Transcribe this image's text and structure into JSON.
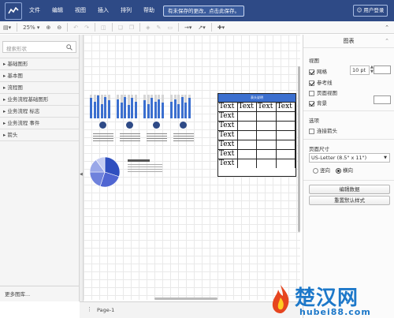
{
  "header": {
    "menu": [
      "文件",
      "编辑",
      "视图",
      "插入",
      "排列",
      "帮助"
    ],
    "unsaved_notice": "有未保存的更改，点击此保存。",
    "user_label": "用户登录"
  },
  "toolbar": {
    "zoom": "25%"
  },
  "sidebar": {
    "search_placeholder": "搜索形状",
    "categories": [
      "基础图形",
      "基本图",
      "流程图",
      "业务流程基础图形",
      "业务流程 标志",
      "业务流程 事件",
      "箭头"
    ],
    "more_label": "更多图库..."
  },
  "canvas": {
    "table": {
      "header": "表头说明",
      "cells": [
        [
          "Text",
          "Text",
          "Text",
          "Text"
        ],
        [
          "Text",
          "",
          "",
          ""
        ],
        [
          "Text",
          "",
          "",
          ""
        ],
        [
          "Text",
          "",
          "",
          ""
        ],
        [
          "Text",
          "",
          "",
          ""
        ],
        [
          "Text",
          "",
          "",
          ""
        ],
        [
          "Text",
          "",
          "",
          ""
        ]
      ]
    },
    "bar_groups": [
      [
        0.85,
        0.7,
        0.95,
        0.6,
        0.9,
        0.75
      ],
      [
        0.8,
        0.65,
        0.9,
        0.55,
        0.85,
        0.7
      ],
      [
        0.75,
        0.6,
        0.85,
        0.7,
        0.8,
        0.65
      ],
      [
        0.7,
        0.8,
        0.6,
        0.9,
        0.65,
        0.85
      ]
    ],
    "pie_values": [
      0.3,
      0.25,
      0.2,
      0.15,
      0.1
    ],
    "accent": "#3b6fcf"
  },
  "page_tab": "Page-1",
  "panel": {
    "title": "图表",
    "view_heading": "视图",
    "grid_label": "网格",
    "grid_size": "10 pt",
    "guides_label": "参考线",
    "page_view_label": "页面视图",
    "background_label": "背景",
    "options_heading": "选项",
    "connection_arrows_label": "连接箭头",
    "page_size_heading": "页面尺寸",
    "page_size_value": "US-Letter (8.5\" x 11\")",
    "portrait_label": "竖向",
    "landscape_label": "横向",
    "edit_data_button": "编辑数据",
    "reset_style_button": "重置默认样式"
  },
  "watermark": {
    "brand": "楚汉网",
    "url": "hubei88.com"
  }
}
